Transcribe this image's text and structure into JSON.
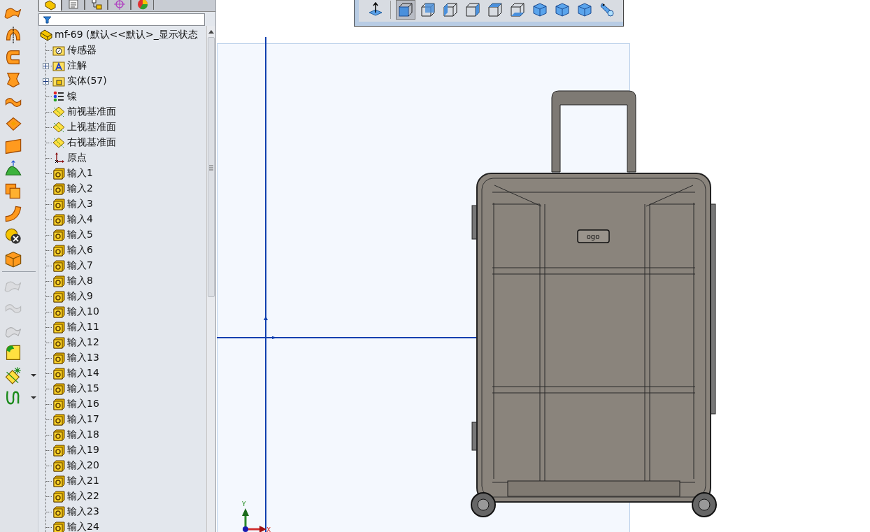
{
  "left_toolbar": {
    "tools": [
      {
        "kind": "surface-extrude",
        "disabled": false,
        "dropdown": false
      },
      {
        "kind": "surface-revolve",
        "disabled": false,
        "dropdown": false
      },
      {
        "kind": "surface-sweep",
        "disabled": false,
        "dropdown": false
      },
      {
        "kind": "surface-loft",
        "disabled": false,
        "dropdown": false
      },
      {
        "kind": "surface-boundary",
        "disabled": false,
        "dropdown": false
      },
      {
        "kind": "surface-fill",
        "disabled": false,
        "dropdown": false
      },
      {
        "kind": "planar",
        "disabled": false,
        "dropdown": false
      },
      {
        "kind": "freeform",
        "disabled": false,
        "dropdown": false
      },
      {
        "kind": "offset",
        "disabled": false,
        "dropdown": false
      },
      {
        "kind": "ruled",
        "disabled": false,
        "dropdown": false
      },
      {
        "kind": "delete-face",
        "disabled": false,
        "dropdown": false
      },
      {
        "kind": "knit",
        "disabled": false,
        "dropdown": false
      }
    ],
    "tools_2": [
      {
        "kind": "surface-extrude",
        "disabled": true,
        "dropdown": false
      },
      {
        "kind": "surface-boundary",
        "disabled": true,
        "dropdown": false
      },
      {
        "kind": "untrim",
        "disabled": true,
        "dropdown": false
      },
      {
        "kind": "fillet",
        "disabled": false,
        "dropdown": false
      },
      {
        "kind": "plane-ref",
        "disabled": false,
        "dropdown": true
      },
      {
        "kind": "curve",
        "disabled": false,
        "dropdown": true
      }
    ]
  },
  "tree_panel": {
    "tabs": [
      {
        "kind": "feature-manager",
        "selected": true
      },
      {
        "kind": "property-manager",
        "selected": false
      },
      {
        "kind": "configuration-manager",
        "selected": false
      },
      {
        "kind": "dimxpert",
        "selected": false
      },
      {
        "kind": "display-manager",
        "selected": false
      }
    ],
    "root": {
      "label": "mf-69 (默认<<默认>_显示状态"
    },
    "items": [
      {
        "kind": "sensor",
        "label": "传感器",
        "expandable": false
      },
      {
        "kind": "annotation",
        "label": "注解",
        "expandable": true
      },
      {
        "kind": "solid-folder",
        "label": "实体(57)",
        "expandable": true
      },
      {
        "kind": "material",
        "label": "镍",
        "expandable": false
      },
      {
        "kind": "plane",
        "label": "前视基准面",
        "expandable": false
      },
      {
        "kind": "plane",
        "label": "上视基准面",
        "expandable": false
      },
      {
        "kind": "plane",
        "label": "右视基准面",
        "expandable": false
      },
      {
        "kind": "origin",
        "label": "原点",
        "expandable": false
      },
      {
        "kind": "import",
        "label": "输入1",
        "expandable": false
      },
      {
        "kind": "import",
        "label": "输入2",
        "expandable": false
      },
      {
        "kind": "import",
        "label": "输入3",
        "expandable": false
      },
      {
        "kind": "import",
        "label": "输入4",
        "expandable": false
      },
      {
        "kind": "import",
        "label": "输入5",
        "expandable": false
      },
      {
        "kind": "import",
        "label": "输入6",
        "expandable": false
      },
      {
        "kind": "import",
        "label": "输入7",
        "expandable": false
      },
      {
        "kind": "import",
        "label": "输入8",
        "expandable": false
      },
      {
        "kind": "import",
        "label": "输入9",
        "expandable": false
      },
      {
        "kind": "import",
        "label": "输入10",
        "expandable": false
      },
      {
        "kind": "import",
        "label": "输入11",
        "expandable": false
      },
      {
        "kind": "import",
        "label": "输入12",
        "expandable": false
      },
      {
        "kind": "import",
        "label": "输入13",
        "expandable": false
      },
      {
        "kind": "import",
        "label": "输入14",
        "expandable": false
      },
      {
        "kind": "import",
        "label": "输入15",
        "expandable": false
      },
      {
        "kind": "import",
        "label": "输入16",
        "expandable": false
      },
      {
        "kind": "import",
        "label": "输入17",
        "expandable": false
      },
      {
        "kind": "import",
        "label": "输入18",
        "expandable": false
      },
      {
        "kind": "import",
        "label": "输入19",
        "expandable": false
      },
      {
        "kind": "import",
        "label": "输入20",
        "expandable": false
      },
      {
        "kind": "import",
        "label": "输入21",
        "expandable": false
      },
      {
        "kind": "import",
        "label": "输入22",
        "expandable": false
      },
      {
        "kind": "import",
        "label": "输入23",
        "expandable": false
      },
      {
        "kind": "import",
        "label": "输入24",
        "expandable": false
      }
    ]
  },
  "view_toolbar": {
    "tools": [
      {
        "kind": "normal-to",
        "selected": false
      },
      {
        "kind": "shaded-edges",
        "selected": true
      },
      {
        "kind": "view-front",
        "selected": false
      },
      {
        "kind": "view-left",
        "selected": false
      },
      {
        "kind": "view-right",
        "selected": false
      },
      {
        "kind": "view-top",
        "selected": false
      },
      {
        "kind": "view-bottom",
        "selected": false
      },
      {
        "kind": "iso-cube",
        "selected": false
      },
      {
        "kind": "iso-cube",
        "selected": false
      },
      {
        "kind": "iso-cube",
        "selected": false
      },
      {
        "kind": "camera",
        "selected": false
      }
    ]
  },
  "viewport": {
    "model": {
      "logo_text": "ogo"
    },
    "triad": {
      "y_label": "Y",
      "x_label": "X"
    }
  }
}
